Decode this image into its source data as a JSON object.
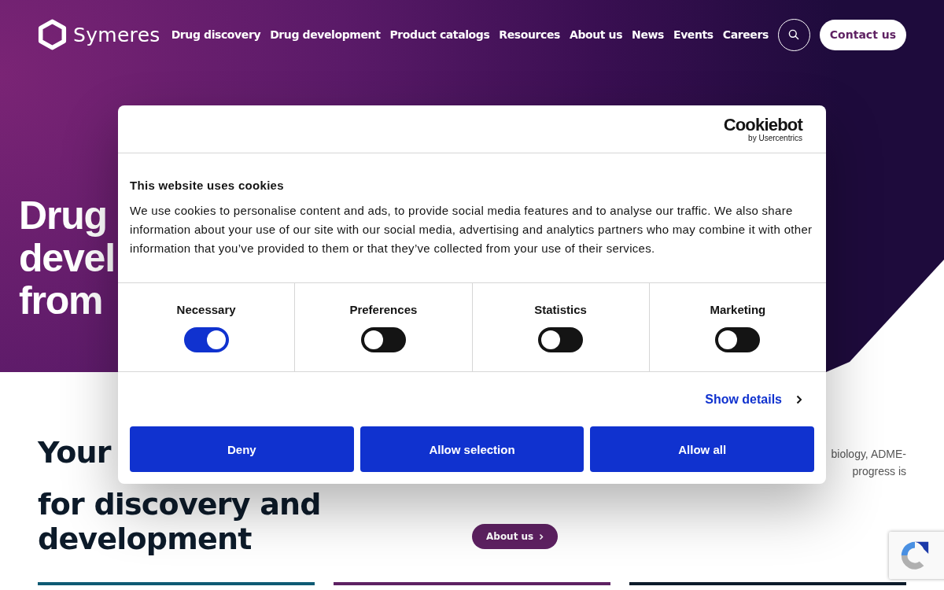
{
  "header": {
    "logo": "Symeres",
    "nav": [
      "Drug discovery",
      "Drug development",
      "Product catalogs",
      "Resources",
      "About us",
      "News",
      "Events",
      "Careers"
    ],
    "contact": "Contact us"
  },
  "hero": {
    "lines": [
      "Drug",
      "devel",
      "from"
    ]
  },
  "intro": {
    "heading": [
      "Your",
      "for discovery and",
      "development"
    ],
    "body": [
      "biology, ADME-",
      "progress is"
    ],
    "button": "About us"
  },
  "cards": [
    {
      "color": "#0e5a73"
    },
    {
      "color": "#5e2162"
    },
    {
      "color": "#0d1b2a"
    }
  ],
  "cookie_dialog": {
    "brand": "Cookiebot",
    "brand_sub": "by Usercentrics",
    "title": "This website uses cookies",
    "text": "We use cookies to personalise content and ads, to provide social media features and to analyse our traffic. We also share information about your use of our site with our social media, advertising and analytics partners who may combine it with other information that you’ve provided to them or that they’ve collected from your use of their services.",
    "toggles": [
      {
        "label": "Necessary",
        "on": true
      },
      {
        "label": "Preferences",
        "on": false
      },
      {
        "label": "Statistics",
        "on": false
      },
      {
        "label": "Marketing",
        "on": false
      }
    ],
    "details_link": "Show details",
    "buttons": [
      "Deny",
      "Allow selection",
      "Allow all"
    ]
  }
}
